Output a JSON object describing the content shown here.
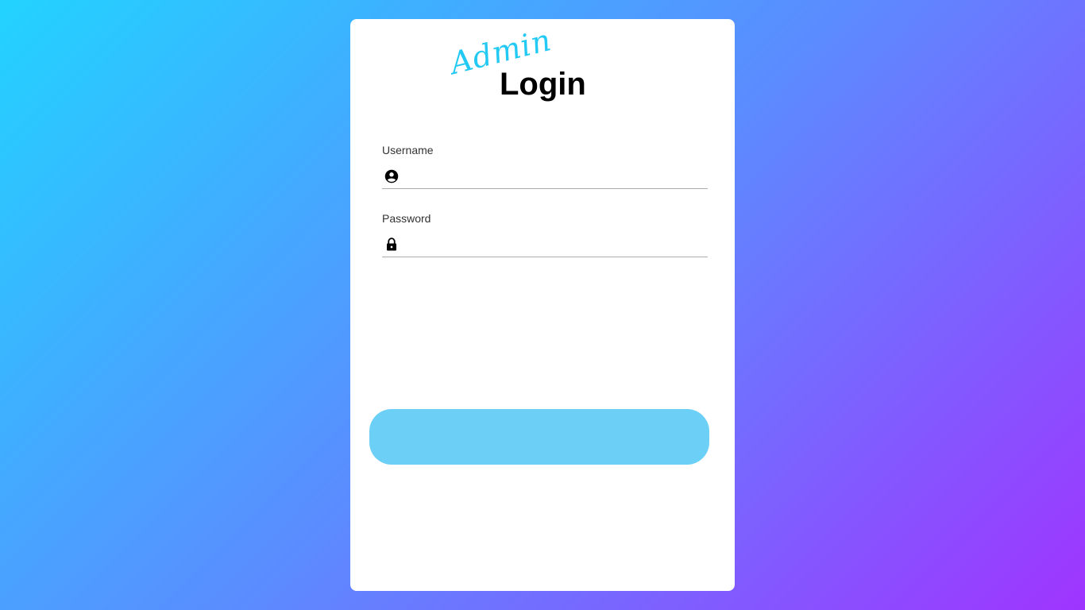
{
  "logo": {
    "script_text": "Admin",
    "bold_text": "Login"
  },
  "form": {
    "username": {
      "label": "Username",
      "value": "",
      "icon": "user-circle-icon"
    },
    "password": {
      "label": "Password",
      "value": "",
      "icon": "lock-icon"
    },
    "submit_label": ""
  },
  "colors": {
    "background_gradient": [
      "#22d3ff",
      "#5b8cff",
      "#9f34ff"
    ],
    "accent": "#22c9f2",
    "button": "#6ccff6"
  }
}
